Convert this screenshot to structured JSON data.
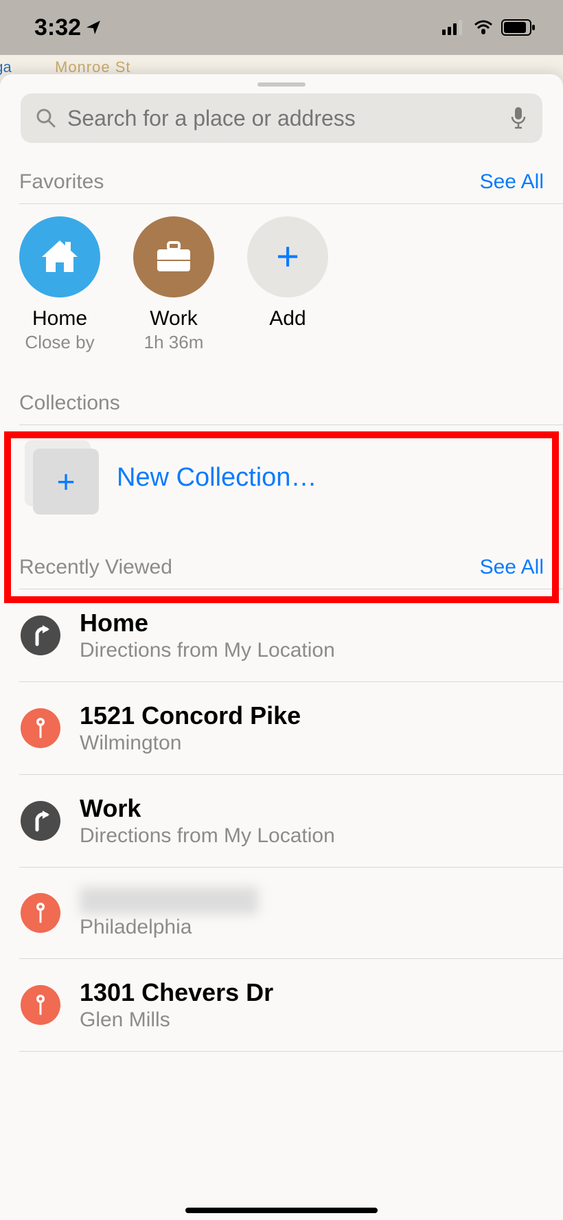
{
  "status": {
    "time": "3:32"
  },
  "search": {
    "placeholder": "Search for a place or address"
  },
  "favorites": {
    "title": "Favorites",
    "see_all": "See All",
    "items": [
      {
        "label": "Home",
        "sub": "Close by"
      },
      {
        "label": "Work",
        "sub": "1h 36m"
      },
      {
        "label": "Add",
        "sub": ""
      }
    ]
  },
  "collections": {
    "title": "Collections",
    "new_label": "New Collection…"
  },
  "recent": {
    "title": "Recently Viewed",
    "see_all": "See All",
    "items": [
      {
        "title": "Home",
        "sub": "Directions from My Location",
        "icon": "directions"
      },
      {
        "title": "1521 Concord Pike",
        "sub": "Wilmington",
        "icon": "pin"
      },
      {
        "title": "Work",
        "sub": "Directions from My Location",
        "icon": "directions"
      },
      {
        "title": "",
        "sub": "Philadelphia",
        "icon": "pin",
        "redacted": true
      },
      {
        "title": "1301 Chevers Dr",
        "sub": "Glen Mills",
        "icon": "pin"
      }
    ]
  },
  "map": {
    "street": "Monroe St",
    "partial": "oga"
  }
}
